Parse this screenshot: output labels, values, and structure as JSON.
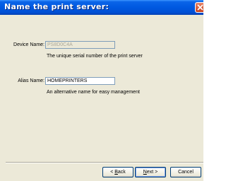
{
  "window": {
    "title": "Name the print server:"
  },
  "device_name": {
    "label": "Device Name:",
    "value": "PS8D0C4A",
    "description": "The unique serial number of the print server"
  },
  "alias_name": {
    "label": "Alias Name:",
    "value": "HOMEPRINTERS",
    "description": "An alternative name for easy management"
  },
  "buttons": {
    "back": {
      "before": "< ",
      "key": "B",
      "after": "ack"
    },
    "next": {
      "key": "N",
      "after": "ext >"
    },
    "cancel": "Cancel"
  },
  "colors": {
    "titlebar": "#0058e0",
    "dialog_bg": "#ece9d8",
    "close": "#c7401c"
  }
}
